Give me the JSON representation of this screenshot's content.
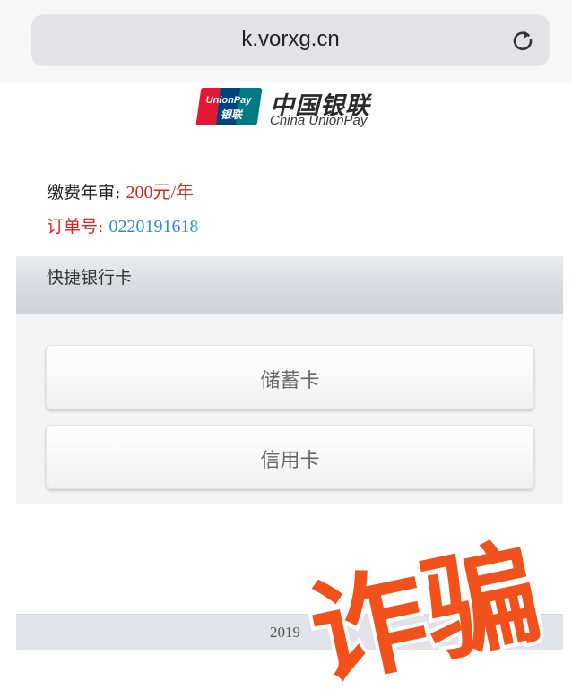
{
  "browser": {
    "url": "k.vorxg.cn",
    "reload_icon": "reload-icon"
  },
  "logo": {
    "badge_text_top": "UnionPay",
    "badge_text_bottom": "银联",
    "name_cn": "中国银联",
    "name_en": "China UnionPay"
  },
  "payment": {
    "fee_label": "缴费年审:",
    "fee_value": "200元/年",
    "order_label": "订单号:",
    "order_value": "0220191618"
  },
  "section": {
    "title": "快捷银行卡"
  },
  "buttons": {
    "debit_label": "储蓄卡",
    "credit_label": "信用卡"
  },
  "footer": {
    "text": "2019"
  },
  "overlay": {
    "stamp_text": "诈骗",
    "stamp_color": "#f2511b"
  },
  "colors": {
    "accent_red": "#d8261d",
    "order_blue": "#2a8bd1",
    "unionpay_red": "#e21836",
    "unionpay_blue": "#00447c",
    "unionpay_green": "#007b84"
  }
}
